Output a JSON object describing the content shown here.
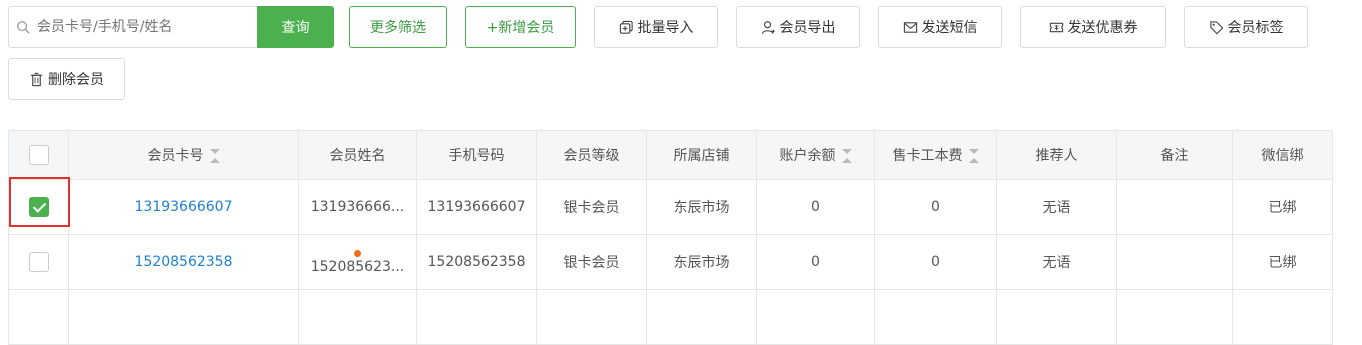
{
  "toolbar": {
    "search_placeholder": "会员卡号/手机号/姓名",
    "query": "查询",
    "more_filter": "更多筛选",
    "add_member": "+新增会员",
    "batch_import": "批量导入",
    "export": "会员导出",
    "send_sms": "发送短信",
    "send_coupon": "发送优惠券",
    "member_tag": "会员标签",
    "delete_member": "删除会员"
  },
  "table": {
    "headers": {
      "card_no": "会员卡号",
      "name": "会员姓名",
      "phone": "手机号码",
      "level": "会员等级",
      "store": "所属店铺",
      "balance": "账户余额",
      "card_fee": "售卡工本费",
      "referrer": "推荐人",
      "remark": "备注",
      "wechat": "微信绑"
    },
    "rows": [
      {
        "checked": true,
        "card_no": "13193666607",
        "name": "131936666...",
        "phone": "13193666607",
        "level": "银卡会员",
        "store": "东辰市场",
        "balance": "0",
        "card_fee": "0",
        "referrer": "无语",
        "remark": "",
        "wechat": "已绑"
      },
      {
        "checked": false,
        "card_no": "15208562358",
        "name": "152085623...",
        "phone": "15208562358",
        "level": "银卡会员",
        "store": "东辰市场",
        "balance": "0",
        "card_fee": "0",
        "referrer": "无语",
        "remark": "",
        "wechat": "已绑"
      }
    ]
  },
  "colors": {
    "accent": "#4bb14e",
    "link": "#1e7fd4",
    "highlight": "#e03030",
    "dot": "#f26b1d"
  }
}
